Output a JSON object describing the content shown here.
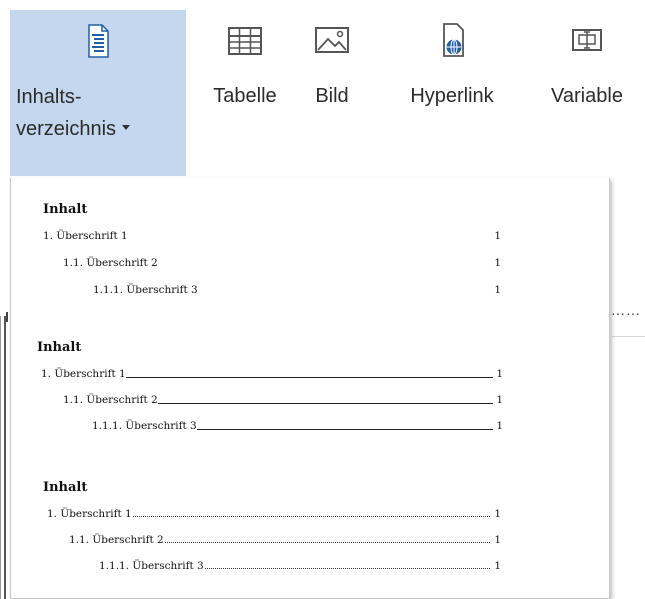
{
  "ribbon": {
    "buttons": [
      {
        "id": "toc",
        "label_line1": "Inhalts-",
        "label_line2": "verzeichnis",
        "icon": "table-of-contents-icon"
      },
      {
        "id": "tabelle",
        "label": "Tabelle",
        "icon": "table-icon"
      },
      {
        "id": "bild",
        "label": "Bild",
        "icon": "picture-icon"
      },
      {
        "id": "hyperlink",
        "label": "Hyperlink",
        "icon": "hyperlink-globe-icon"
      },
      {
        "id": "variable",
        "label": "Variable",
        "icon": "variable-field-icon"
      }
    ],
    "active_color": "#c5d7ee",
    "icon_color": "#1f5fa8"
  },
  "document": {
    "right_dots": "……"
  },
  "gallery": {
    "styles": [
      {
        "title": "Inhalt",
        "leader": "none",
        "entries": [
          {
            "text": "1. Überschrift 1",
            "page": "1"
          },
          {
            "text": "1.1. Überschrift 2",
            "page": "1"
          },
          {
            "text": "1.1.1. Überschrift 3",
            "page": "1"
          }
        ]
      },
      {
        "title": "Inhalt",
        "leader": "underline",
        "entries": [
          {
            "text": "1. Überschrift 1",
            "page": "1"
          },
          {
            "text": "1.1. Überschrift 2",
            "page": "1"
          },
          {
            "text": "1.1.1. Überschrift 3",
            "page": "1"
          }
        ]
      },
      {
        "title": "Inhalt",
        "leader": "dotted",
        "entries": [
          {
            "text": "1. Überschrift 1",
            "page": "1"
          },
          {
            "text": "1.1. Überschrift 2",
            "page": "1"
          },
          {
            "text": "1.1.1. Überschrift 3",
            "page": "1"
          }
        ]
      }
    ]
  }
}
